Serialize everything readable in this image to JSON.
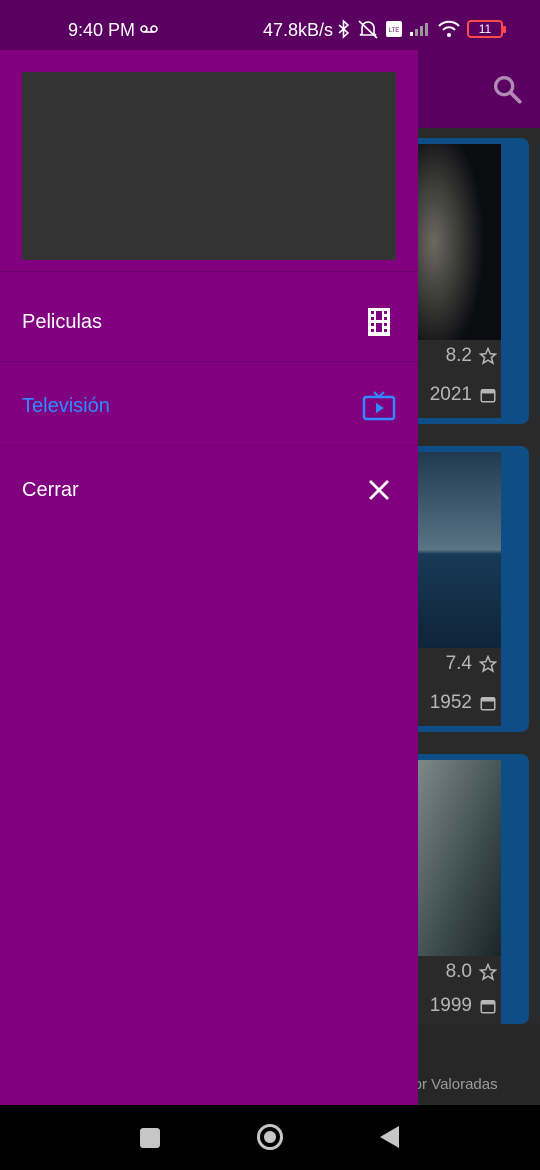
{
  "status_bar": {
    "time": "9:40 PM",
    "network_speed": "47.8kB/s",
    "battery_level": "11",
    "icons": [
      "voicemail-icon",
      "bluetooth-icon",
      "mute-icon",
      "volte-icon",
      "signal-icon",
      "wifi-icon",
      "battery-icon"
    ]
  },
  "drawer": {
    "menu": [
      {
        "label": "Peliculas",
        "icon": "film-icon",
        "active": false
      },
      {
        "label": "Televisión",
        "icon": "tv-icon",
        "active": true
      },
      {
        "label": "Cerrar",
        "icon": "close-icon",
        "active": false
      }
    ],
    "colors": {
      "background": "#800080",
      "active": "#2f8bff",
      "text": "#ffffff",
      "header_image": "#333333"
    }
  },
  "background_app": {
    "cards": [
      {
        "rating": "8.2",
        "year": "2021"
      },
      {
        "rating": "7.4",
        "year": "1952"
      },
      {
        "rating": "8.0",
        "year": "1999"
      }
    ],
    "bottom_nav_label": "ejor Valoradas",
    "colors": {
      "topbar": "#5a0060",
      "card": "#0e4d86"
    }
  }
}
